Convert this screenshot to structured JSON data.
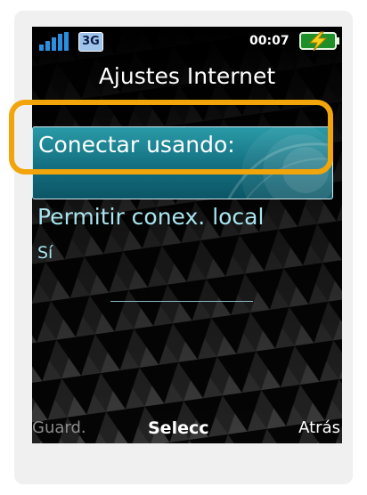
{
  "status_bar": {
    "network_type": "3G",
    "time": "00:07",
    "signal_icon": "signal-strength-icon",
    "battery_icon": "battery-charging-icon"
  },
  "screen": {
    "title": "Ajustes Internet"
  },
  "options": [
    {
      "label": "Conectar usando:",
      "selected": true
    },
    {
      "label": "Permitir conex. local",
      "value": "Sí",
      "selected": false
    }
  ],
  "softkeys": {
    "left": "Guard.",
    "center": "Selecc",
    "right": "Atrás"
  },
  "colors": {
    "highlight_ring": "#f2a40b",
    "selection_bar": "#136f80",
    "unselected_text": "#a8e4ee",
    "disabled_softkey": "#8c8c8c"
  }
}
